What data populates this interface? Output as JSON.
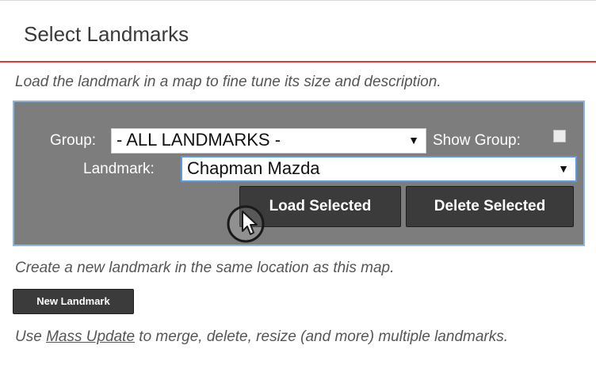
{
  "header": {
    "title": "Select Landmarks"
  },
  "intro_hint": "Load the landmark in a map to fine tune its size and description.",
  "selector": {
    "group_label": "Group:",
    "group_value": "- ALL LANDMARKS -",
    "show_group_label": "Show Group:",
    "show_group_checked": false,
    "landmark_label": "Landmark:",
    "landmark_value": "Chapman Mazda",
    "load_button": "Load Selected",
    "delete_button": "Delete Selected"
  },
  "create_hint": "Create a new landmark in the same location as this map.",
  "new_button": "New Landmark",
  "mass_update": {
    "prefix": "Use ",
    "link": "Mass Update",
    "suffix": " to merge, delete, resize (and more) multiple landmarks."
  },
  "icons": {
    "dropdown": "dropdown-arrow-icon",
    "cursor": "mouse-pointer-icon"
  }
}
